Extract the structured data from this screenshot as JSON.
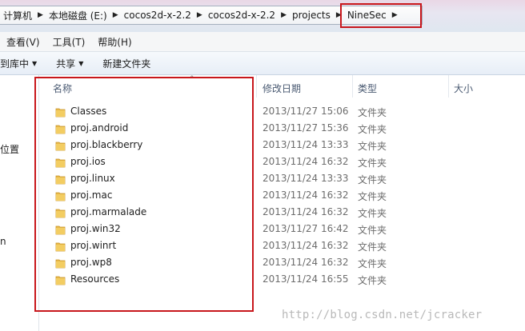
{
  "address": {
    "crumbs": [
      "计算机",
      "本地磁盘 (E:)",
      "cocos2d-x-2.2",
      "cocos2d-x-2.2",
      "projects",
      "NineSec"
    ],
    "separator": "▶"
  },
  "menu": {
    "items": [
      "查看(V)",
      "工具(T)",
      "帮助(H)"
    ]
  },
  "toolbar": {
    "include_label": "到库中",
    "share_label": "共享",
    "new_folder_label": "新建文件夹"
  },
  "nav": {
    "partial1": "位置",
    "partial2": "n"
  },
  "columns": {
    "name": "名称",
    "date": "修改日期",
    "type": "类型",
    "size": "大小"
  },
  "files": [
    {
      "name": "Classes",
      "date": "2013/11/27 15:06",
      "type": "文件夹"
    },
    {
      "name": "proj.android",
      "date": "2013/11/27 15:36",
      "type": "文件夹"
    },
    {
      "name": "proj.blackberry",
      "date": "2013/11/24 13:33",
      "type": "文件夹"
    },
    {
      "name": "proj.ios",
      "date": "2013/11/24 16:32",
      "type": "文件夹"
    },
    {
      "name": "proj.linux",
      "date": "2013/11/24 13:33",
      "type": "文件夹"
    },
    {
      "name": "proj.mac",
      "date": "2013/11/24 16:32",
      "type": "文件夹"
    },
    {
      "name": "proj.marmalade",
      "date": "2013/11/24 16:32",
      "type": "文件夹"
    },
    {
      "name": "proj.win32",
      "date": "2013/11/27 16:42",
      "type": "文件夹"
    },
    {
      "name": "proj.winrt",
      "date": "2013/11/24 16:32",
      "type": "文件夹"
    },
    {
      "name": "proj.wp8",
      "date": "2013/11/24 16:32",
      "type": "文件夹"
    },
    {
      "name": "Resources",
      "date": "2013/11/24 16:55",
      "type": "文件夹"
    }
  ],
  "watermark": "http://blog.csdn.net/jcracker",
  "colors": {
    "highlight_border": "#c8171c",
    "folder": "#e8b94a"
  }
}
